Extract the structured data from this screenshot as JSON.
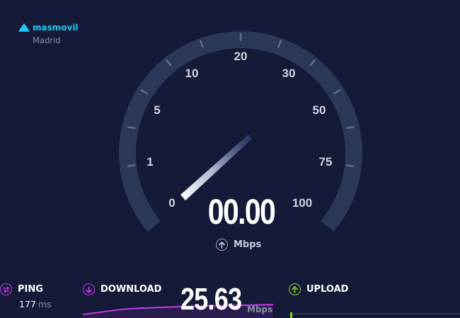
{
  "provider": {
    "name": "masmovil",
    "city": "Madrid",
    "icon": "triangle-icon"
  },
  "gauge": {
    "ticks": [
      "0",
      "1",
      "5",
      "10",
      "20",
      "30",
      "50",
      "75",
      "100"
    ],
    "value": "00.00",
    "unit": "Mbps",
    "unit_icon": "upload-arrow-icon"
  },
  "metrics": {
    "ping": {
      "label": "PING",
      "value": "177",
      "unit": "ms",
      "color": "#c43be8"
    },
    "download": {
      "label": "DOWNLOAD",
      "value": "25.63",
      "unit": "Mbps",
      "color": "#c43be8"
    },
    "upload": {
      "label": "UPLOAD",
      "color": "#8ad12a"
    }
  },
  "colors": {
    "background": "#141a38",
    "accent": "#1ec8f0",
    "gauge_track": "#2c3859"
  }
}
